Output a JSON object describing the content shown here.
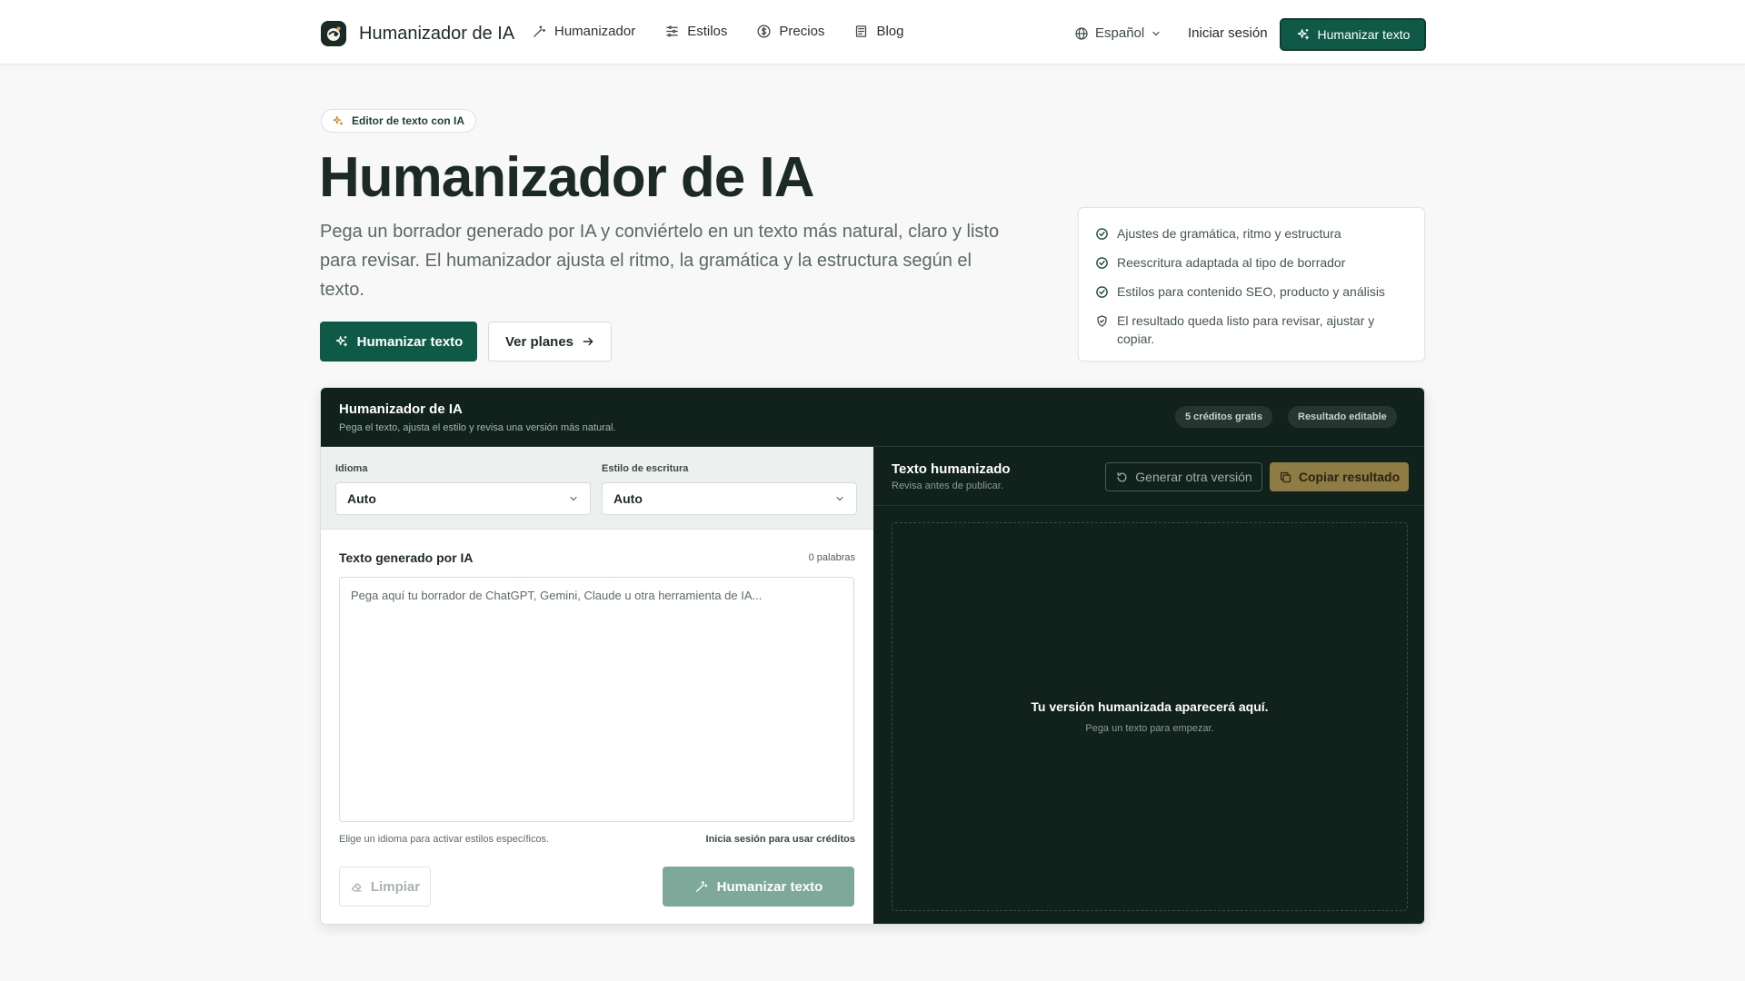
{
  "header": {
    "brand": "Humanizador de IA",
    "nav": [
      {
        "label": "Humanizador",
        "icon": "magic-wand-icon"
      },
      {
        "label": "Estilos",
        "icon": "sliders-icon"
      },
      {
        "label": "Precios",
        "icon": "dollar-circle-icon"
      },
      {
        "label": "Blog",
        "icon": "newspaper-icon"
      }
    ],
    "language": "Español",
    "login": "Iniciar sesión",
    "cta": "Humanizar texto"
  },
  "hero": {
    "badge": "Editor de texto con IA",
    "title": "Humanizador de IA",
    "description": "Pega un borrador generado por IA y conviértelo en un texto más natural, claro y listo para revisar. El humanizador ajusta el ritmo, la gramática y la estructura según el texto.",
    "primary_button": "Humanizar texto",
    "secondary_button": "Ver planes",
    "features": [
      {
        "text": "Ajustes de gramática, ritmo y estructura",
        "icon": "check-circle-icon"
      },
      {
        "text": "Reescritura adaptada al tipo de borrador",
        "icon": "check-circle-icon"
      },
      {
        "text": "Estilos para contenido SEO, producto y análisis",
        "icon": "check-circle-icon"
      },
      {
        "text": "El resultado queda listo para revisar, ajustar y copiar.",
        "icon": "shield-check-icon"
      }
    ]
  },
  "tool": {
    "title": "Humanizador de IA",
    "subtitle": "Pega el texto, ajusta el estilo y revisa una versión más natural.",
    "pills": [
      "5 créditos gratis",
      "Resultado editable"
    ],
    "input": {
      "language_label": "Idioma",
      "language_value": "Auto",
      "style_label": "Estilo de escritura",
      "style_value": "Auto",
      "title": "Texto generado por IA",
      "word_count": "0 palabras",
      "placeholder": "Pega aquí tu borrador de ChatGPT, Gemini, Claude u otra herramienta de IA...",
      "hint": "Elige un idioma para activar estilos específicos.",
      "login_hint": "Inicia sesión para usar créditos",
      "clear_button": "Limpiar",
      "humanize_button": "Humanizar texto"
    },
    "output": {
      "title": "Texto humanizado",
      "subtitle": "Revisa antes de publicar.",
      "regenerate_button": "Generar otra versión",
      "copy_button": "Copiar resultado",
      "empty_title": "Tu versión humanizada aparecerá aquí.",
      "empty_subtitle": "Pega un texto para empezar."
    }
  },
  "colors": {
    "accent": "#0f5a46",
    "dark_panel": "#11221d",
    "gold": "#8f7c45",
    "page_bg": "#f7f8f7"
  }
}
